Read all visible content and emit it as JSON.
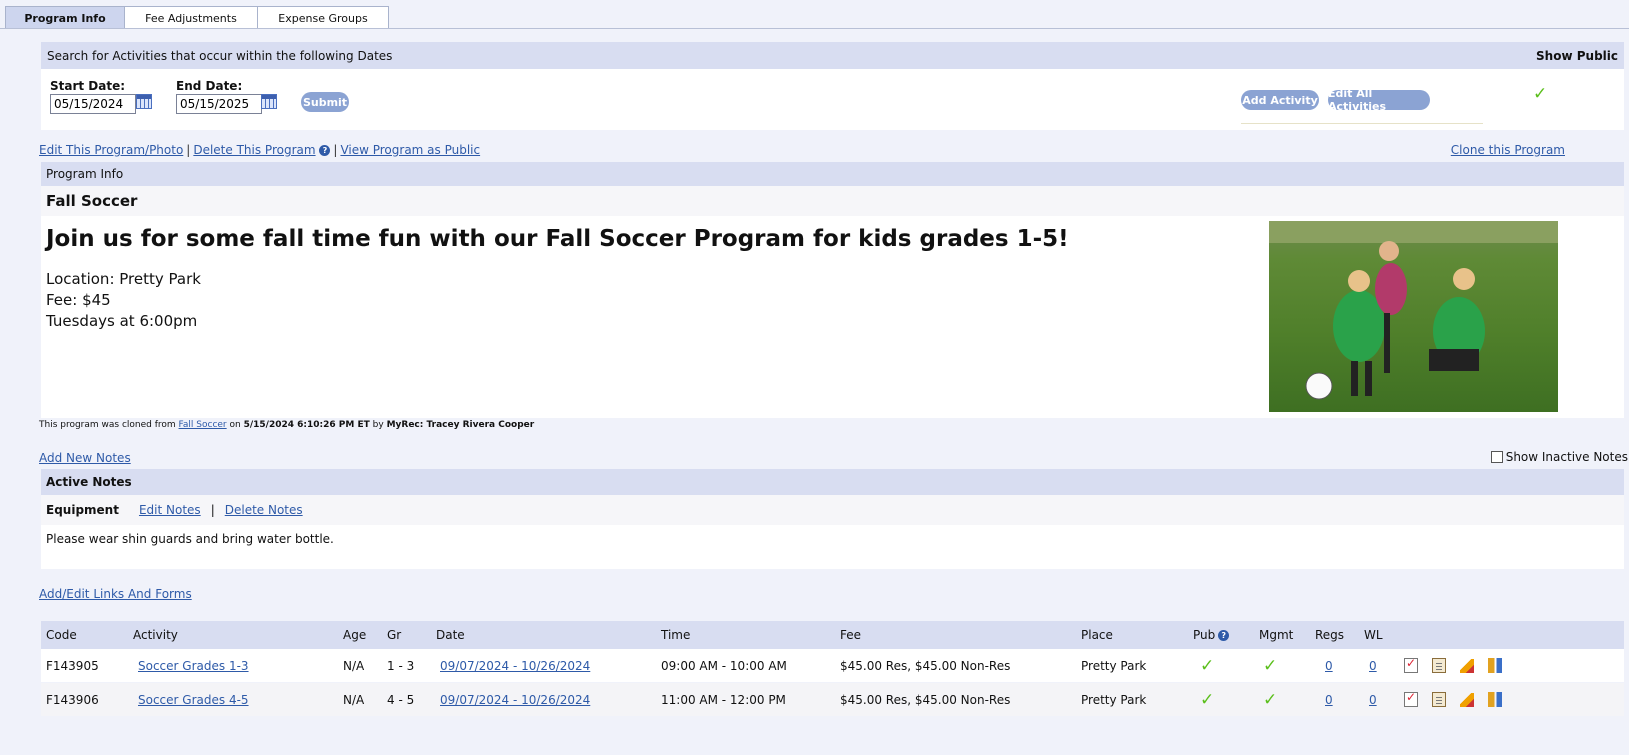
{
  "tabs": [
    "Program Info",
    "Fee Adjustments",
    "Expense Groups"
  ],
  "search": {
    "title": "Search for Activities that occur within the following Dates",
    "show_public_label": "Show Public",
    "start_label": "Start Date:",
    "start_value": "05/15/2024",
    "end_label": "End Date:",
    "end_value": "05/15/2025",
    "submit": "Submit",
    "add_activity": "Add Activity",
    "edit_all": "Edit All Activities"
  },
  "program_links": {
    "edit": "Edit This Program/Photo",
    "delete": "Delete This Program",
    "view_public": "View Program as Public",
    "clone": "Clone this Program",
    "sep": "|"
  },
  "program": {
    "section_title": "Program Info",
    "name": "Fall Soccer",
    "headline": "Join us for some fall time fun with our Fall Soccer Program for kids grades 1-5!",
    "location": "Location: Pretty Park",
    "fee": "Fee: $45",
    "schedule": "Tuesdays at 6:00pm",
    "clone_prefix": "This program was cloned from",
    "clone_source": "Fall Soccer",
    "clone_on": "on",
    "clone_datetime": "5/15/2024 6:10:26 PM ET",
    "clone_by": "by",
    "clone_user": "MyRec: Tracey Rivera Cooper"
  },
  "notes": {
    "add_link": "Add New Notes",
    "show_inactive": "Show Inactive Notes",
    "section_title": "Active Notes",
    "category": "Equipment",
    "edit": "Edit Notes",
    "sep": "|",
    "delete": "Delete Notes",
    "text": "Please wear shin guards and bring water bottle."
  },
  "links_forms": "Add/Edit Links And Forms",
  "activities": {
    "headers": [
      "Code",
      "Activity",
      "Age",
      "Gr",
      "Date",
      "Time",
      "Fee",
      "Place",
      "Pub",
      "Mgmt",
      "Regs",
      "WL"
    ],
    "rows": [
      {
        "code": "F143905",
        "activity": "Soccer Grades 1-3",
        "age": "N/A",
        "gr": "1 - 3",
        "date": "09/07/2024 - 10/26/2024",
        "time": "09:00 AM - 10:00 AM",
        "fee": "$45.00 Res, $45.00 Non-Res",
        "place": "Pretty Park",
        "regs": "0",
        "wl": "0"
      },
      {
        "code": "F143906",
        "activity": "Soccer Grades 4-5",
        "age": "N/A",
        "gr": "4 - 5",
        "date": "09/07/2024 - 10/26/2024",
        "time": "11:00 AM - 12:00 PM",
        "fee": "$45.00 Res, $45.00 Non-Res",
        "place": "Pretty Park",
        "regs": "0",
        "wl": "0"
      }
    ],
    "check_symbol": "✓"
  }
}
